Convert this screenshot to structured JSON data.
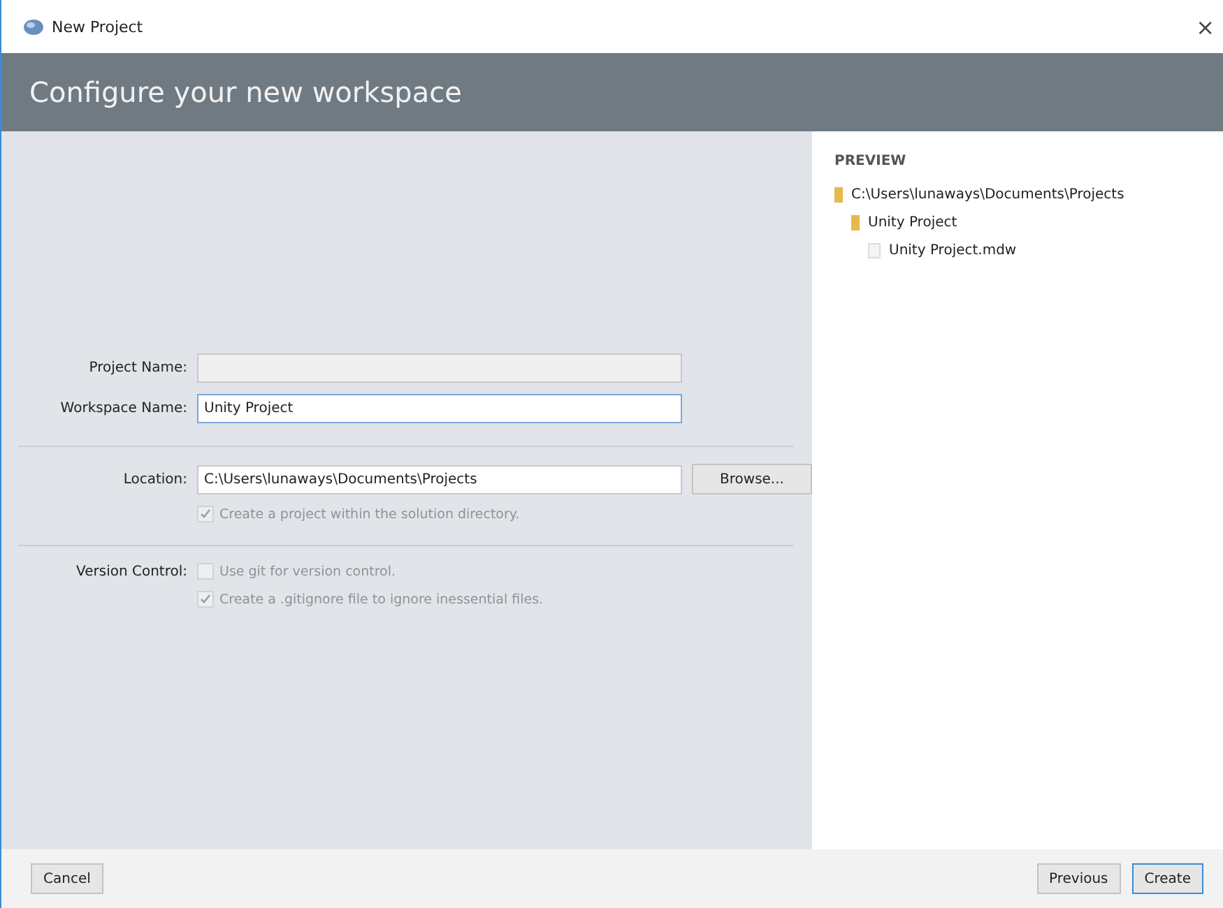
{
  "window": {
    "title": "New Project",
    "close": "×"
  },
  "header": {
    "title": "Configure your new workspace"
  },
  "form": {
    "project_name": {
      "label": "Project Name:",
      "disabled": true
    },
    "workspace_name": {
      "label": "Workspace Name:",
      "value": "Unity Project",
      "disabled": false
    },
    "location": {
      "label": "Location:",
      "value": "C:\\Users\\lunaways\\Documents\\Projects",
      "browse": "Browse..."
    },
    "location_options": [
      {
        "label": "Create a project within the solution directory.",
        "checked": true,
        "disabled": true
      }
    ],
    "version_control": {
      "label": "Version Control:",
      "options": [
        {
          "label": "Use git for version control.",
          "checked": false,
          "disabled": true
        },
        {
          "label": "Create a .gitignore file to ignore inessential files.",
          "checked": true,
          "disabled": true
        }
      ]
    }
  },
  "preview": {
    "title": "PREVIEW",
    "tree": [
      {
        "kind": "folder",
        "label": "C:\\Users\\lunaways\\Documents\\Projects",
        "children": [
          {
            "kind": "folder",
            "label": "Unity Project",
            "children": [
              {
                "kind": "file",
                "label": "Unity Project.mdw"
              }
            ]
          }
        ]
      }
    ]
  },
  "footer": {
    "cancel": "Cancel",
    "previous": "Previous",
    "create": "Create"
  }
}
